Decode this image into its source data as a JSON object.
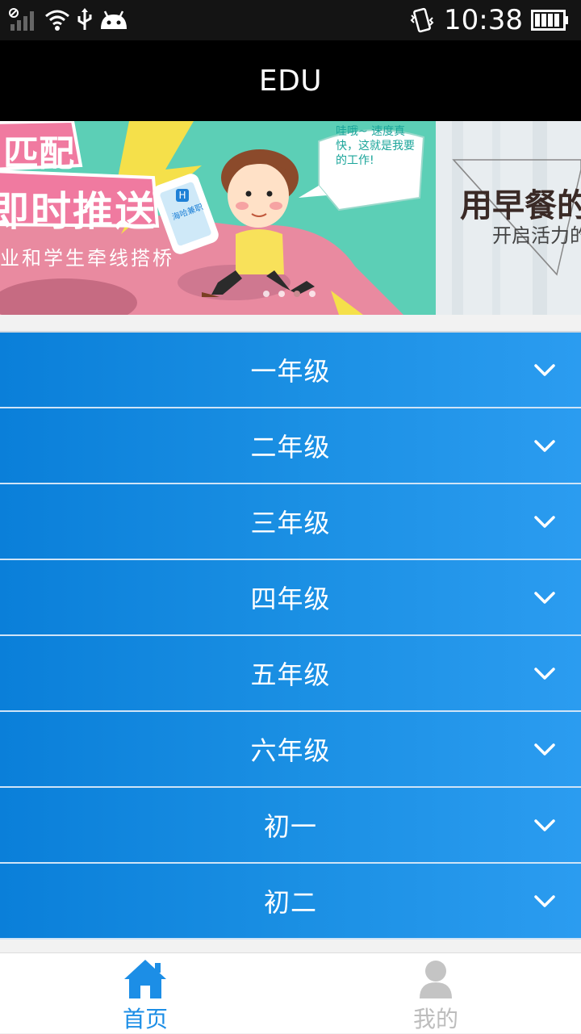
{
  "status_bar": {
    "time": "10:38",
    "icons": [
      "signal-icon",
      "wifi-icon",
      "usb-icon",
      "android-icon",
      "vibrate-icon",
      "battery-icon"
    ]
  },
  "app_bar": {
    "title": "EDU"
  },
  "banner": {
    "slide1": {
      "headline_top": "匹配",
      "headline": "即时推送",
      "subline": "业和学生牵线搭桥",
      "bubble": "哇哦~ 速度真快，这就是我要的工作!",
      "phone_logo": "H",
      "phone_text": "海哈兼职"
    },
    "slide2": {
      "headline": "用早餐的",
      "subline": "开启活力的"
    },
    "dot_count": 4,
    "active_dot": 2
  },
  "grades": [
    {
      "label": "一年级"
    },
    {
      "label": "二年级"
    },
    {
      "label": "三年级"
    },
    {
      "label": "四年级"
    },
    {
      "label": "五年级"
    },
    {
      "label": "六年级"
    },
    {
      "label": "初一"
    },
    {
      "label": "初二"
    }
  ],
  "tabbar": {
    "home": {
      "label": "首页",
      "icon": "home-icon"
    },
    "mine": {
      "label": "我的",
      "icon": "user-icon"
    }
  },
  "colors": {
    "accent": "#1c8ee6",
    "row_gradient_start": "#0a7fd9",
    "row_gradient_end": "#2b9cf0",
    "app_bar": "#000000"
  }
}
